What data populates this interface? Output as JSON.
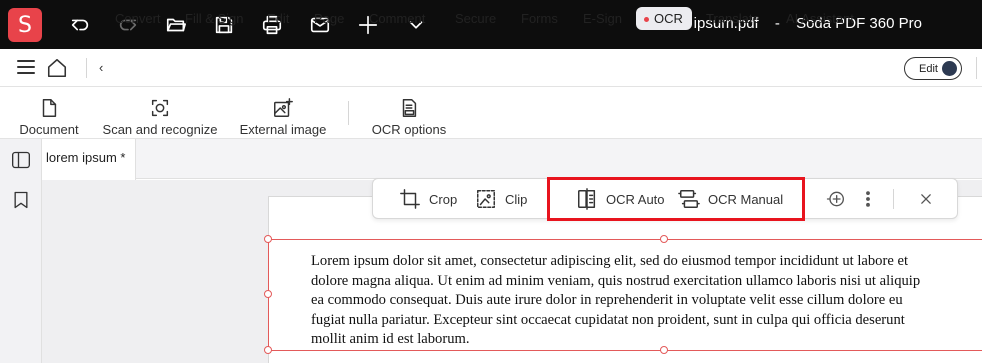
{
  "app": {
    "logo_letter": "S",
    "document_name": "lorem ipsum.pdf",
    "separator": "-",
    "app_name": "Soda PDF 360 Pro",
    "accent_color": "#e8434a"
  },
  "titlebar": {
    "icons": [
      "undo-icon",
      "redo-icon",
      "open-folder-icon",
      "save-icon",
      "print-icon",
      "mail-icon",
      "new-icon",
      "chevron-down-icon"
    ]
  },
  "menu": {
    "items": [
      {
        "label": "Convert"
      },
      {
        "label": "Fill & Sign"
      },
      {
        "label": "Edit"
      },
      {
        "label": "Page"
      },
      {
        "label": "Comment"
      },
      {
        "label": "Secure"
      },
      {
        "label": "Forms"
      },
      {
        "label": "E-Sign"
      },
      {
        "label": "OCR",
        "active": true
      },
      {
        "label": "Translate"
      },
      {
        "label": "AI Assistant"
      }
    ],
    "edit_toggle_label": "Edit"
  },
  "ribbon": {
    "buttons": [
      {
        "label": "Document",
        "icon": "document-icon"
      },
      {
        "label": "Scan and recognize",
        "icon": "scan-icon"
      },
      {
        "label": "External image",
        "icon": "image-add-icon"
      },
      {
        "label": "OCR options",
        "icon": "ocr-options-icon"
      }
    ]
  },
  "tabs": {
    "document_tab": "lorem ipsum *"
  },
  "floating_toolbar": {
    "crop_label": "Crop",
    "clip_label": "Clip",
    "ocr_auto_label": "OCR Auto",
    "ocr_manual_label": "OCR Manual",
    "highlight_color": "#e8141e"
  },
  "document": {
    "lines": [
      "Lorem ipsum dolor sit amet, consectetur adipiscing elit, sed do eiusmod tempor incididunt ut labore et",
      "dolore magna aliqua. Ut enim ad minim veniam, quis nostrud exercitation ullamco laboris nisi ut aliquip",
      "ea commodo consequat. Duis aute irure dolor in reprehenderit in voluptate velit esse cillum dolore eu",
      "fugiat nulla pariatur. Excepteur sint occaecat cupidatat non proident, sunt in culpa qui officia deserunt",
      "mollit anim id est laborum."
    ]
  }
}
